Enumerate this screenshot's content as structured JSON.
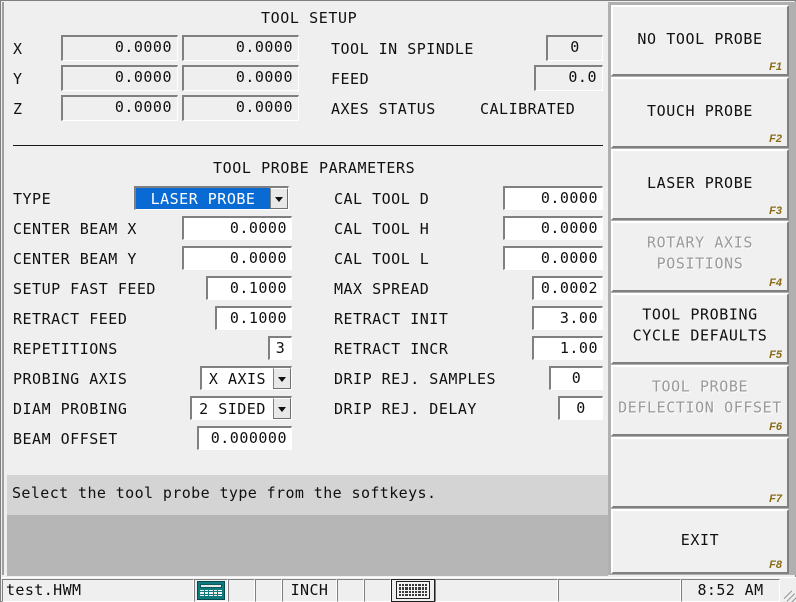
{
  "tool_setup": {
    "title": "TOOL SETUP",
    "axes": [
      {
        "label": "X",
        "machine": "0.0000",
        "work": "0.0000"
      },
      {
        "label": "Y",
        "machine": "0.0000",
        "work": "0.0000"
      },
      {
        "label": "Z",
        "machine": "0.0000",
        "work": "0.0000"
      }
    ],
    "tool_in_spindle_label": "TOOL IN SPINDLE",
    "tool_in_spindle_value": "0",
    "feed_label": "FEED",
    "feed_value": "0.0",
    "axes_status_label": "AXES STATUS",
    "axes_status_value": "CALIBRATED"
  },
  "probe_params": {
    "title": "TOOL PROBE PARAMETERS",
    "left": {
      "type_label": "TYPE",
      "type_value": "LASER PROBE",
      "center_beam_x_label": "CENTER BEAM X",
      "center_beam_x_value": "0.0000",
      "center_beam_y_label": "CENTER BEAM Y",
      "center_beam_y_value": "0.0000",
      "setup_fast_feed_label": "SETUP FAST FEED",
      "setup_fast_feed_value": "0.1000",
      "retract_feed_label": "RETRACT FEED",
      "retract_feed_value": "0.1000",
      "repetitions_label": "REPETITIONS",
      "repetitions_value": "3",
      "probing_axis_label": "PROBING AXIS",
      "probing_axis_value": "X AXIS",
      "diam_probing_label": "DIAM PROBING",
      "diam_probing_value": "2 SIDED",
      "beam_offset_label": "BEAM OFFSET",
      "beam_offset_value": "0.000000"
    },
    "right": {
      "cal_tool_d_label": "CAL TOOL D",
      "cal_tool_d_value": "0.0000",
      "cal_tool_h_label": "CAL TOOL H",
      "cal_tool_h_value": "0.0000",
      "cal_tool_l_label": "CAL TOOL L",
      "cal_tool_l_value": "0.0000",
      "max_spread_label": "MAX SPREAD",
      "max_spread_value": "0.0002",
      "retract_init_label": "RETRACT INIT",
      "retract_init_value": "3.00",
      "retract_incr_label": "RETRACT INCR",
      "retract_incr_value": "1.00",
      "drip_rej_samples_label": "DRIP REJ. SAMPLES",
      "drip_rej_samples_value": "0",
      "drip_rej_delay_label": "DRIP REJ. DELAY",
      "drip_rej_delay_value": "0"
    }
  },
  "message": "Select the tool probe type from the softkeys.",
  "softkeys": [
    {
      "label": "NO TOOL PROBE",
      "fkey": "F1",
      "disabled": false
    },
    {
      "label": "TOUCH PROBE",
      "fkey": "F2",
      "disabled": false
    },
    {
      "label": "LASER PROBE",
      "fkey": "F3",
      "disabled": false
    },
    {
      "label": "ROTARY AXIS\nPOSITIONS",
      "fkey": "F4",
      "disabled": true
    },
    {
      "label": "TOOL PROBING\nCYCLE DEFAULTS",
      "fkey": "F5",
      "disabled": false
    },
    {
      "label": "TOOL PROBE\nDEFLECTION OFFSET",
      "fkey": "F6",
      "disabled": true
    },
    {
      "label": "",
      "fkey": "F7",
      "disabled": false
    },
    {
      "label": "EXIT",
      "fkey": "F8",
      "disabled": false
    }
  ],
  "statusbar": {
    "filename": "test.HWM",
    "calculator_icon": "calculator-icon",
    "units": "INCH",
    "keyboard_icon": "keyboard-icon",
    "time": "8:52 AM"
  },
  "colors": {
    "selection_blue": "#0a6ad4",
    "fkey_olive": "#8a6d16",
    "panel_gray": "#efefef",
    "message_band": "#d4d4d4",
    "message_band_dark": "#b6b6b6",
    "calc_teal": "#0e7a7e"
  }
}
